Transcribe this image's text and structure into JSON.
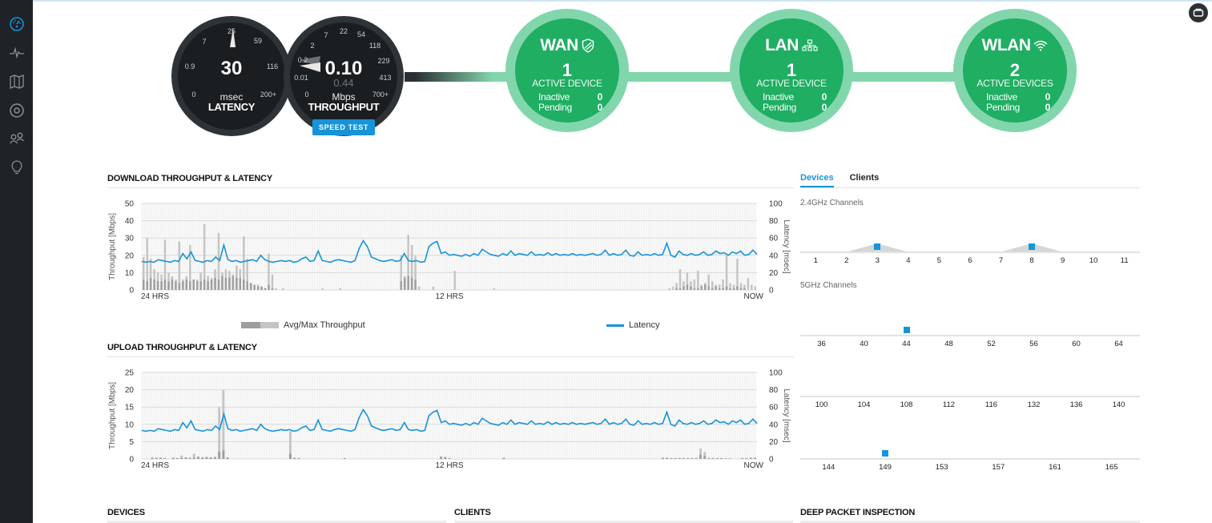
{
  "sidebar": {
    "items": [
      {
        "name": "dashboard",
        "icon": "speedometer-icon",
        "active": true
      },
      {
        "name": "statistics",
        "icon": "pulse-icon",
        "active": false
      },
      {
        "name": "map",
        "icon": "map-icon",
        "active": false
      },
      {
        "name": "devices",
        "icon": "target-icon",
        "active": false
      },
      {
        "name": "clients",
        "icon": "users-icon",
        "active": false
      },
      {
        "name": "insights",
        "icon": "lightbulb-icon",
        "active": false
      }
    ]
  },
  "corner_button": {
    "icon": "chat-icon"
  },
  "latency_gauge": {
    "ticks": [
      "0",
      "0.9",
      "7",
      "25",
      "59",
      "116",
      "200+"
    ],
    "value": "30",
    "unit": "msec",
    "label": "LATENCY"
  },
  "throughput_gauge": {
    "ticks": [
      "0",
      "0.01",
      "0.2",
      "2",
      "7",
      "22",
      "54",
      "118",
      "229",
      "413",
      "700+"
    ],
    "value": "0.10",
    "secondary_value": "0.44",
    "unit": "Mbps",
    "label": "THROUGHPUT",
    "speed_test_label": "SPEED TEST"
  },
  "networks": [
    {
      "title": "WAN",
      "icon": "shield-icon",
      "count": "1",
      "active_label": "ACTIVE DEVICE",
      "inactive_label": "Inactive",
      "inactive": "0",
      "pending_label": "Pending",
      "pending": "0"
    },
    {
      "title": "LAN",
      "icon": "network-icon",
      "count": "1",
      "active_label": "ACTIVE DEVICE",
      "inactive_label": "Inactive",
      "inactive": "0",
      "pending_label": "Pending",
      "pending": "0"
    },
    {
      "title": "WLAN",
      "icon": "wifi-icon",
      "count": "2",
      "active_label": "ACTIVE DEVICES",
      "inactive_label": "Inactive",
      "inactive": "0",
      "pending_label": "Pending",
      "pending": "0"
    }
  ],
  "colors": {
    "accent": "#1694d9",
    "green": "#1fae62",
    "green_light": "#82d6ac",
    "gauge_dark": "#1b1e21",
    "bar_avg": "#9e9e9e",
    "bar_max": "#c4c4c4"
  },
  "legend": {
    "throughput": "Avg/Max Throughput",
    "latency": "Latency"
  },
  "chart_data": [
    {
      "type": "bar",
      "title": "DOWNLOAD THROUGHPUT & LATENCY",
      "xlabel": "",
      "ylabel": "Throughput [Mbps]",
      "y2label": "Latency [msec]",
      "ylim": [
        0,
        50
      ],
      "y2lim": [
        0,
        100
      ],
      "yticks": [
        "0",
        "10",
        "20",
        "30",
        "40",
        "50"
      ],
      "y2ticks": [
        "0",
        "20",
        "40",
        "60",
        "80",
        "100"
      ],
      "xticks": [
        "24 HRS",
        "12 HRS",
        "NOW"
      ],
      "grid": true,
      "series": [
        {
          "name": "Avg Throughput",
          "values": [
            6,
            5,
            7,
            6,
            5,
            5,
            6,
            5,
            6,
            5,
            4,
            5,
            6,
            5,
            6,
            5,
            5,
            6,
            5,
            6,
            7,
            6,
            8,
            7,
            7,
            8,
            7,
            7,
            6,
            5,
            4,
            3,
            2,
            2,
            1,
            3,
            1,
            0,
            0,
            0,
            0,
            0,
            0,
            0,
            0,
            0,
            0,
            0,
            0,
            0,
            0,
            0,
            0,
            0,
            0,
            0,
            0,
            0,
            0,
            0,
            0,
            0,
            0,
            0,
            0,
            0,
            0,
            0,
            0,
            0,
            0,
            0,
            5,
            7,
            8,
            7,
            6,
            0,
            0,
            0,
            0,
            0,
            0,
            0,
            0,
            0,
            0,
            0,
            0,
            0,
            0,
            0,
            0,
            0,
            0,
            0,
            0,
            0,
            0,
            0,
            0,
            0,
            0,
            0,
            0,
            0,
            0,
            0,
            0,
            0,
            0,
            0,
            0,
            0,
            0,
            0,
            0,
            0,
            0,
            0,
            0,
            0,
            0,
            0,
            0,
            0,
            0,
            0,
            0,
            0,
            0,
            0,
            0,
            0,
            0,
            0,
            0,
            0,
            0,
            0,
            0,
            0,
            0,
            0,
            0,
            0,
            0,
            0,
            0,
            1,
            1,
            2,
            3,
            2,
            1,
            1,
            2,
            3,
            2,
            1,
            2,
            1,
            1,
            2,
            1,
            1,
            2,
            1,
            1
          ]
        },
        {
          "name": "Max Throughput",
          "values": [
            19,
            30,
            18,
            12,
            10,
            9,
            29,
            10,
            8,
            6,
            28,
            6,
            8,
            26,
            5,
            6,
            10,
            38,
            8,
            7,
            12,
            33,
            10,
            12,
            11,
            9,
            14,
            12,
            31,
            18,
            4,
            2,
            3,
            2,
            1,
            21,
            9,
            1,
            0,
            1,
            0,
            0,
            0,
            0,
            0,
            0,
            0,
            0,
            0,
            0,
            1,
            0,
            0,
            0,
            0,
            1,
            0,
            0,
            0,
            0,
            0,
            0,
            0,
            0,
            0,
            0,
            0,
            0,
            0,
            0,
            0,
            0,
            20,
            8,
            32,
            26,
            20,
            2,
            0,
            0,
            0,
            2,
            0,
            0,
            0,
            0,
            0,
            11,
            0,
            0,
            0,
            0,
            0,
            0,
            0,
            0,
            0,
            0,
            1,
            0,
            0,
            0,
            0,
            0,
            0,
            0,
            0,
            0,
            0,
            0,
            0,
            0,
            0,
            0,
            0,
            0,
            0,
            0,
            0,
            0,
            0,
            0,
            0,
            0,
            0,
            0,
            0,
            0,
            0,
            0,
            0,
            0,
            0,
            0,
            0,
            0,
            0,
            0,
            0,
            0,
            0,
            0,
            0,
            0,
            0,
            0,
            0,
            1,
            2,
            4,
            12,
            5,
            10,
            5,
            6,
            11,
            3,
            4,
            9,
            5,
            3,
            3,
            6,
            20,
            4,
            3,
            18,
            4,
            3,
            7,
            3,
            2
          ]
        },
        {
          "name": "Latency",
          "axis": "y2",
          "values": [
            33,
            32,
            33,
            32,
            35,
            34,
            33,
            32,
            34,
            33,
            42,
            36,
            44,
            34,
            33,
            32,
            34,
            33,
            38,
            34,
            52,
            35,
            33,
            34,
            32,
            33,
            34,
            35,
            33,
            40,
            35,
            33,
            32,
            33,
            34,
            33,
            34,
            32,
            33,
            36,
            38,
            33,
            34,
            45,
            34,
            33,
            32,
            34,
            35,
            34,
            33,
            32,
            34,
            48,
            57,
            50,
            38,
            36,
            34,
            33,
            34,
            35,
            33,
            34,
            42,
            34,
            33,
            34,
            32,
            33,
            50,
            54,
            56,
            42,
            44,
            40,
            41,
            40,
            39,
            41,
            39,
            42,
            40,
            47,
            44,
            41,
            40,
            39,
            42,
            40,
            45,
            40,
            42,
            41,
            40,
            44,
            40,
            41,
            40,
            43,
            40,
            42,
            40,
            41,
            40,
            42,
            40,
            41,
            40,
            41,
            42,
            40,
            41,
            46,
            40,
            42,
            40,
            41,
            46,
            40,
            39,
            44,
            40,
            41,
            40,
            42,
            40,
            41,
            54,
            40,
            38,
            45,
            41,
            40,
            42,
            40,
            41,
            44,
            40,
            41,
            45,
            42,
            43,
            40,
            44,
            42,
            45,
            40,
            41,
            46,
            41
          ]
        }
      ]
    },
    {
      "type": "bar",
      "title": "UPLOAD THROUGHPUT & LATENCY",
      "xlabel": "",
      "ylabel": "Throughput [Mbps]",
      "y2label": "Latency [msec]",
      "ylim": [
        0,
        25
      ],
      "y2lim": [
        0,
        100
      ],
      "yticks": [
        "0",
        "5",
        "10",
        "15",
        "20",
        "25"
      ],
      "y2ticks": [
        "0",
        "20",
        "40",
        "60",
        "80",
        "100"
      ],
      "xticks": [
        "24 HRS",
        "12 HRS",
        "NOW"
      ],
      "grid": true,
      "series": [
        {
          "name": "Avg Throughput",
          "values": [
            0,
            0,
            0.3,
            0.3,
            0.3,
            0.2,
            0,
            0.3,
            0.2,
            0.3,
            0.4,
            0.3,
            0.3,
            0.6,
            0.4,
            0.5,
            0.4,
            0.5,
            2,
            2.5,
            0.4,
            0,
            0,
            0,
            0,
            0,
            0,
            0,
            0,
            0,
            0,
            0,
            0,
            0,
            0,
            1.5,
            0.3,
            0.2,
            0,
            0,
            0,
            0,
            0,
            0,
            0,
            0,
            0,
            0,
            0.2,
            0,
            0,
            0,
            0,
            0,
            0,
            0,
            0,
            0,
            0,
            0,
            0,
            0,
            0,
            0,
            0,
            0,
            0,
            0,
            0,
            0,
            0,
            0.6,
            0.5,
            0.2,
            0,
            0,
            0,
            0,
            0,
            0,
            0,
            0,
            0,
            0,
            0,
            0,
            0.3,
            0,
            0,
            0,
            0,
            0,
            0,
            0,
            0,
            0,
            0,
            0,
            0,
            0,
            0,
            0,
            0,
            0,
            0,
            0,
            0,
            0,
            0,
            0,
            0,
            0,
            0,
            0,
            0,
            0,
            0,
            0,
            0,
            0,
            0,
            0,
            0,
            0,
            0.3,
            0.3,
            0.2,
            0.2,
            0.2,
            0.2,
            0.2,
            0.2,
            0.2,
            1.2,
            0.8,
            0.2,
            0.2,
            0.2,
            0.2,
            0.1,
            0.1,
            0,
            0,
            0.2,
            0.2,
            0.3,
            0.3
          ]
        },
        {
          "name": "Max Throughput",
          "values": [
            0,
            0,
            0.5,
            0.4,
            0.4,
            0.3,
            0,
            0.4,
            0.3,
            1,
            0.5,
            0.4,
            1.5,
            0.7,
            0.5,
            0.6,
            0.5,
            0.6,
            15,
            20,
            0.5,
            0,
            0,
            0,
            0,
            0,
            0,
            0,
            0,
            0,
            0,
            0,
            0,
            0,
            0,
            8,
            0.4,
            0.3,
            0,
            0,
            0,
            0,
            0,
            0,
            0,
            0,
            0,
            0,
            0.3,
            0,
            0,
            0,
            0,
            0,
            0,
            0,
            0,
            0,
            0,
            0,
            0,
            0,
            0,
            0,
            0,
            0,
            0,
            0,
            0,
            0,
            0,
            0.7,
            0.6,
            0.3,
            0,
            0,
            0,
            0,
            0,
            0,
            0,
            0,
            0,
            0,
            0,
            0,
            0.4,
            0,
            0,
            0,
            0,
            0,
            0,
            0,
            0,
            0,
            0,
            0,
            0,
            0,
            0,
            0,
            0,
            0,
            0,
            0,
            0,
            0,
            0,
            0,
            0,
            0,
            0,
            0,
            0,
            0,
            0,
            0,
            0,
            0,
            0,
            0,
            0,
            0,
            0.4,
            0.4,
            0.3,
            0.3,
            0.3,
            0.3,
            0.3,
            0.3,
            0.3,
            3,
            2,
            0.3,
            0.3,
            0.3,
            0.3,
            0.2,
            0.2,
            0,
            0,
            0.3,
            0.3,
            0.4,
            0.4
          ]
        },
        {
          "name": "Latency",
          "axis": "y2",
          "values": [
            33,
            32,
            33,
            32,
            35,
            34,
            33,
            32,
            34,
            33,
            42,
            36,
            44,
            34,
            33,
            32,
            34,
            33,
            38,
            34,
            52,
            35,
            33,
            34,
            32,
            33,
            34,
            35,
            33,
            40,
            35,
            33,
            32,
            33,
            34,
            33,
            34,
            32,
            33,
            36,
            38,
            33,
            34,
            45,
            34,
            33,
            32,
            34,
            35,
            34,
            33,
            32,
            34,
            48,
            57,
            50,
            38,
            36,
            34,
            33,
            34,
            35,
            33,
            34,
            42,
            34,
            33,
            34,
            32,
            33,
            50,
            54,
            56,
            42,
            44,
            40,
            41,
            40,
            39,
            41,
            39,
            42,
            40,
            47,
            44,
            41,
            40,
            39,
            42,
            40,
            45,
            40,
            42,
            41,
            40,
            44,
            40,
            41,
            40,
            43,
            40,
            42,
            40,
            41,
            40,
            42,
            40,
            41,
            40,
            41,
            42,
            40,
            41,
            46,
            40,
            42,
            40,
            41,
            46,
            40,
            39,
            44,
            40,
            41,
            40,
            42,
            40,
            41,
            54,
            40,
            38,
            45,
            41,
            40,
            42,
            40,
            41,
            44,
            40,
            41,
            45,
            42,
            43,
            40,
            44,
            42,
            45,
            40,
            41,
            46,
            41
          ]
        }
      ]
    }
  ],
  "channels": {
    "tabs": [
      {
        "label": "Devices",
        "active": true
      },
      {
        "label": "Clients",
        "active": false
      }
    ],
    "band_24": {
      "label": "2.4GHz Channels",
      "channels": [
        "1",
        "2",
        "3",
        "4",
        "5",
        "6",
        "7",
        "8",
        "9",
        "10",
        "11"
      ],
      "used": [
        "3",
        "8"
      ]
    },
    "band_5": {
      "label": "5GHz Channels",
      "rows": [
        {
          "channels": [
            "36",
            "40",
            "44",
            "48",
            "52",
            "56",
            "60",
            "64"
          ],
          "used": [
            "44"
          ]
        },
        {
          "channels": [
            "100",
            "104",
            "108",
            "112",
            "116",
            "132",
            "136",
            "140"
          ],
          "used": []
        },
        {
          "channels": [
            "144",
            "149",
            "153",
            "157",
            "161",
            "165"
          ],
          "used": [
            "149"
          ]
        }
      ]
    }
  },
  "bottom_sections": {
    "devices": "DEVICES",
    "clients": "CLIENTS",
    "dpi": "DEEP PACKET INSPECTION"
  }
}
